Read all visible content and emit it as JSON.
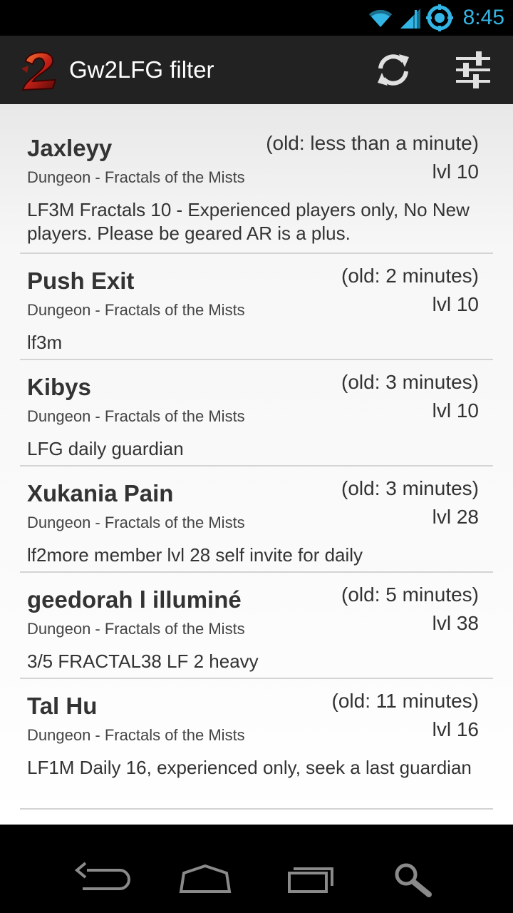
{
  "status_bar": {
    "time": "8:45",
    "icons": [
      "wifi-icon",
      "cell-signal-icon",
      "sync-status-icon"
    ]
  },
  "action_bar": {
    "title": "Gw2LFG filter",
    "logo_icon": "guild-wars-2-logo",
    "actions": [
      {
        "name": "refresh",
        "icon": "refresh-icon"
      },
      {
        "name": "filter-settings",
        "icon": "sliders-icon"
      }
    ]
  },
  "listings": [
    {
      "name": "Jaxleyy",
      "age": "(old: less than a minute)",
      "category": "Dungeon - Fractals of the Mists",
      "level": "lvl 10",
      "message": "LF3M Fractals 10 - Experienced players only, No New players. Please be geared AR is a plus."
    },
    {
      "name": "Push Exit",
      "age": "(old: 2 minutes)",
      "category": "Dungeon - Fractals of the Mists",
      "level": "lvl 10",
      "message": "lf3m"
    },
    {
      "name": "Kibys",
      "age": "(old: 3 minutes)",
      "category": "Dungeon - Fractals of the Mists",
      "level": "lvl 10",
      "message": "LFG daily guardian"
    },
    {
      "name": "Xukania Pain",
      "age": "(old: 3 minutes)",
      "category": "Dungeon - Fractals of the Mists",
      "level": "lvl 28",
      "message": "lf2more member lvl 28 self invite for daily"
    },
    {
      "name": "geedorah l illuminé",
      "age": "(old: 5 minutes)",
      "category": "Dungeon - Fractals of the Mists",
      "level": "lvl 38",
      "message": "3/5 FRACTAL38 LF 2 heavy"
    },
    {
      "name": "Tal Hu",
      "age": "(old: 11 minutes)",
      "category": "Dungeon - Fractals of the Mists",
      "level": "lvl 16",
      "message": "LF1M Daily 16, experienced only, seek a last guardian"
    }
  ],
  "nav_bar": {
    "buttons": [
      {
        "name": "back",
        "icon": "back-icon"
      },
      {
        "name": "home",
        "icon": "home-icon"
      },
      {
        "name": "recent-apps",
        "icon": "recent-apps-icon"
      },
      {
        "name": "search",
        "icon": "search-icon"
      }
    ]
  },
  "colors": {
    "status_accent": "#33b5e5",
    "action_bar_bg": "#222222",
    "text_primary": "#333333",
    "divider": "#d4d4d4"
  }
}
